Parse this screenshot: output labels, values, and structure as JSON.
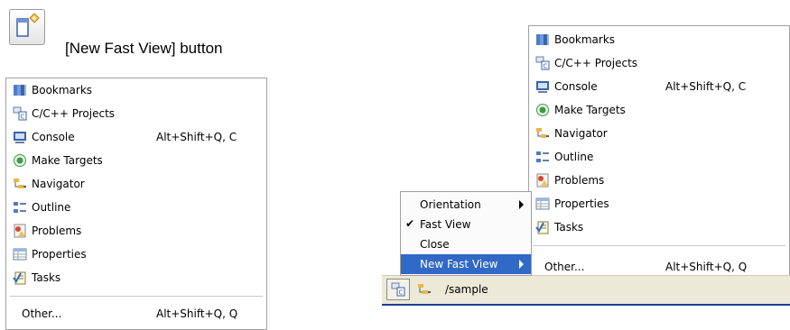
{
  "caption": "[New Fast View] button",
  "left_menu": {
    "items": [
      {
        "label": "Bookmarks",
        "accel": "",
        "icon": "bookmarks-icon"
      },
      {
        "label": "C/C++ Projects",
        "accel": "",
        "icon": "cpp-projects-icon"
      },
      {
        "label": "Console",
        "accel": "Alt+Shift+Q, C",
        "icon": "console-icon"
      },
      {
        "label": "Make Targets",
        "accel": "",
        "icon": "make-targets-icon"
      },
      {
        "label": "Navigator",
        "accel": "",
        "icon": "navigator-icon"
      },
      {
        "label": "Outline",
        "accel": "",
        "icon": "outline-icon"
      },
      {
        "label": "Problems",
        "accel": "",
        "icon": "problems-icon"
      },
      {
        "label": "Properties",
        "accel": "",
        "icon": "properties-icon"
      },
      {
        "label": "Tasks",
        "accel": "",
        "icon": "tasks-icon"
      }
    ],
    "other": {
      "label": "Other...",
      "accel": "Alt+Shift+Q, Q"
    }
  },
  "right_menu": {
    "items": [
      {
        "label": "Bookmarks",
        "accel": ""
      },
      {
        "label": "C/C++ Projects",
        "accel": ""
      },
      {
        "label": "Console",
        "accel": "Alt+Shift+Q, C"
      },
      {
        "label": "Make Targets",
        "accel": ""
      },
      {
        "label": "Navigator",
        "accel": ""
      },
      {
        "label": "Outline",
        "accel": ""
      },
      {
        "label": "Problems",
        "accel": ""
      },
      {
        "label": "Properties",
        "accel": ""
      },
      {
        "label": "Tasks",
        "accel": ""
      }
    ],
    "other": {
      "label": "Other...",
      "accel": "Alt+Shift+Q, Q"
    }
  },
  "context_menu": {
    "items": [
      {
        "label": "Orientation",
        "checked": false,
        "submenu": true
      },
      {
        "label": "Fast View",
        "checked": true,
        "submenu": false
      },
      {
        "label": "Close",
        "checked": false,
        "submenu": false
      },
      {
        "label": "New Fast View",
        "checked": false,
        "submenu": true,
        "active": true
      }
    ]
  },
  "statusbar": {
    "path": "/sample"
  },
  "colors": {
    "highlight": "#3169c6",
    "statusbar": "#ece9d8"
  }
}
